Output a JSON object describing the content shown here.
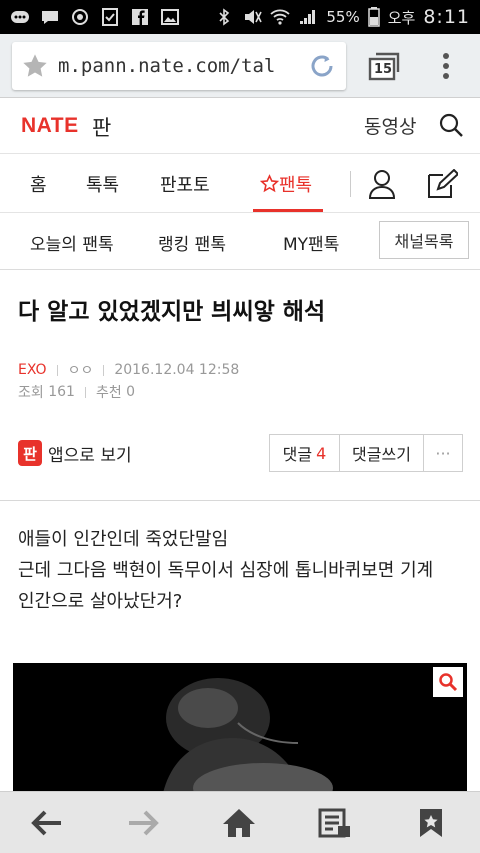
{
  "status_bar": {
    "battery_percent": "55%",
    "time_prefix": "오후",
    "time": "8:11",
    "icons": [
      "talk-icon",
      "chat-bubble-icon",
      "circle-icon",
      "checklist-icon",
      "facebook-icon",
      "image-icon",
      "bluetooth-icon",
      "mute-icon",
      "wifi-icon",
      "signal-icon",
      "battery-icon"
    ]
  },
  "browser": {
    "url": "m.pann.nate.com/tal",
    "tab_count": "15"
  },
  "header": {
    "logo": "NATE",
    "logo_suffix": "판",
    "video_link": "동영상"
  },
  "gnb": {
    "items": [
      {
        "label": "홈"
      },
      {
        "label": "톡톡"
      },
      {
        "label": "판포토"
      },
      {
        "label": "팬톡",
        "active": true
      }
    ]
  },
  "subnav": {
    "items": [
      {
        "label": "오늘의 팬톡"
      },
      {
        "label": "랭킹 팬톡"
      },
      {
        "label": "MY팬톡"
      }
    ],
    "channel_button": "채널목록"
  },
  "post": {
    "title": "다 알고 있었겠지만 븨씨앟 해석",
    "channel": "EXO",
    "author": "ㅇㅇ",
    "datetime": "2016.12.04 12:58",
    "views_label": "조회",
    "views": "161",
    "recommend_label": "추천",
    "recommend": "0",
    "app_view_badge": "판",
    "app_view_label": "앱으로 보기",
    "comments_label": "댓글",
    "comments_count": "4",
    "write_comment_label": "댓글쓰기",
    "more_label": "···",
    "body_lines": [
      "애들이 인간인데 죽었단말임",
      "근데 그다음 백현이 독무이서 심장에 톱니바퀴보면 기계",
      "인간으로 살아났단거?"
    ]
  },
  "colors": {
    "accent": "#e8322b",
    "url_bar_bg": "#eceff1",
    "bottom_bar_bg": "#e6e6e6"
  }
}
